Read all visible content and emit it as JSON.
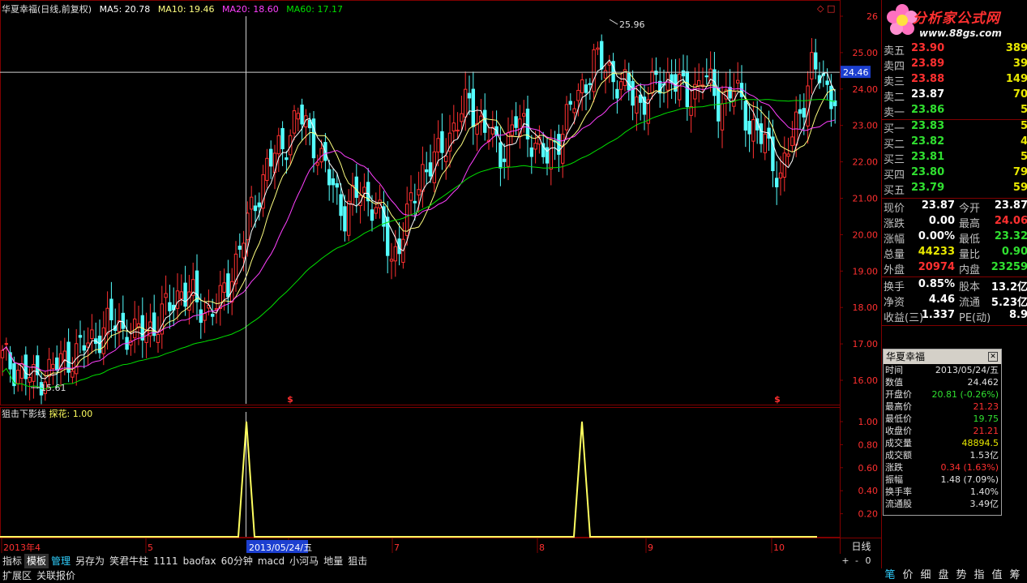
{
  "stock_name": "华夏幸福",
  "chart_info": {
    "title": "华夏幸福(日线,前复权)",
    "ma5": "MA5: 20.78",
    "ma10": "MA10: 19.46",
    "ma20": "MA20: 18.60",
    "ma60": "MA60: 17.17"
  },
  "sub_info": {
    "indicator": "狙击下影线",
    "value": "探花: 1.00"
  },
  "colors": {
    "up": "#ff3030",
    "down": "#54ffff",
    "ma5": "#ffffff",
    "ma10": "#ffff80",
    "ma20": "#ff40ff",
    "ma60": "#00e000",
    "grid": "#800000",
    "indicator": "#ffff60"
  },
  "price_axis": [
    "26",
    "25.00",
    "24.00",
    "23.00",
    "22.00",
    "21.00",
    "20.00",
    "19.00",
    "18.00",
    "17.00",
    "16.00"
  ],
  "sub_axis": [
    "1.00",
    "0.80",
    "0.60",
    "0.40",
    "0.20"
  ],
  "crosshair_price": "24.46",
  "annotations": {
    "high": "25.96",
    "low": "15.61"
  },
  "signal_marks": [
    "$",
    "$"
  ],
  "date_axis": {
    "labels": [
      "2013年4",
      "5",
      "6",
      "7",
      "8",
      "9",
      "10"
    ],
    "selected": "2013/05/24/五"
  },
  "period_label": "日线",
  "order_book": {
    "asks": [
      {
        "label": "卖五",
        "price": "23.90",
        "vol": "389"
      },
      {
        "label": "卖四",
        "price": "23.89",
        "vol": "39"
      },
      {
        "label": "卖三",
        "price": "23.88",
        "vol": "149"
      },
      {
        "label": "卖二",
        "price": "23.87",
        "vol": "70"
      },
      {
        "label": "卖一",
        "price": "23.86",
        "vol": "5"
      }
    ],
    "bids": [
      {
        "label": "买一",
        "price": "23.83",
        "vol": "5"
      },
      {
        "label": "买二",
        "price": "23.82",
        "vol": "4"
      },
      {
        "label": "买三",
        "price": "23.81",
        "vol": "5"
      },
      {
        "label": "买四",
        "price": "23.80",
        "vol": "79"
      },
      {
        "label": "买五",
        "price": "23.79",
        "vol": "59"
      }
    ]
  },
  "stats": [
    {
      "l1": "现价",
      "v1": "23.87",
      "c1": "#ffffff",
      "l2": "今开",
      "v2": "23.87",
      "c2": "#ffffff"
    },
    {
      "l1": "涨跌",
      "v1": "0.00",
      "c1": "#ffffff",
      "l2": "最高",
      "v2": "24.06",
      "c2": "#ff3030"
    },
    {
      "l1": "涨幅",
      "v1": "0.00%",
      "c1": "#ffffff",
      "l2": "最低",
      "v2": "23.32",
      "c2": "#30e030"
    },
    {
      "l1": "总量",
      "v1": "44233",
      "c1": "#e8e800",
      "l2": "量比",
      "v2": "0.90",
      "c2": "#30e030"
    },
    {
      "l1": "外盘",
      "v1": "20974",
      "c1": "#ff3030",
      "l2": "内盘",
      "v2": "23259",
      "c2": "#30e030"
    }
  ],
  "stats2": [
    {
      "l1": "换手",
      "v1": "0.85%",
      "c1": "#ffffff",
      "l2": "股本",
      "v2": "13.2亿",
      "c2": "#ffffff"
    },
    {
      "l1": "净资",
      "v1": "4.46",
      "c1": "#ffffff",
      "l2": "流通",
      "v2": "5.23亿",
      "c2": "#ffffff"
    },
    {
      "l1": "收益(三)",
      "v1": "1.337",
      "c1": "#ffffff",
      "l2": "PE(动)",
      "v2": "8.9",
      "c2": "#ffffff"
    }
  ],
  "logo": {
    "brand": "分析家公式网",
    "url": "www.88gs.com"
  },
  "info_popup": {
    "title": "华夏幸福",
    "rows": [
      {
        "k": "时间",
        "v": "2013/05/24/五",
        "c": "#e0e0e0"
      },
      {
        "k": "数值",
        "v": "24.462",
        "c": "#e0e0e0"
      },
      {
        "k": "开盘价",
        "v": "20.81 (-0.26%)",
        "c": "#30e030"
      },
      {
        "k": "最高价",
        "v": "21.23",
        "c": "#ff3030"
      },
      {
        "k": "最低价",
        "v": "19.75",
        "c": "#30e030"
      },
      {
        "k": "收盘价",
        "v": "21.21",
        "c": "#ff3030"
      },
      {
        "k": "成交量",
        "v": "48894.5",
        "c": "#e8e800"
      },
      {
        "k": "成交额",
        "v": "1.53亿",
        "c": "#e0e0e0"
      },
      {
        "k": "涨跌",
        "v": "0.34 (1.63%)",
        "c": "#ff3030"
      },
      {
        "k": "振幅",
        "v": "1.48 (7.09%)",
        "c": "#e0e0e0"
      },
      {
        "k": "换手率",
        "v": "1.40%",
        "c": "#e0e0e0"
      },
      {
        "k": "流通股",
        "v": "3.49亿",
        "c": "#e0e0e0"
      }
    ]
  },
  "tabs": [
    "指标",
    "模板",
    "管理",
    "另存为",
    "笑君牛柱",
    "1111",
    "baofax",
    "60分钟",
    "macd",
    "小河马",
    "地量",
    "狙击"
  ],
  "status_tabs": [
    "扩展区",
    "关联报价"
  ],
  "right_tabs": [
    "笔",
    "价",
    "细",
    "盘",
    "势",
    "指",
    "值",
    "筹"
  ],
  "zoom": [
    "+",
    "-",
    "0"
  ]
}
